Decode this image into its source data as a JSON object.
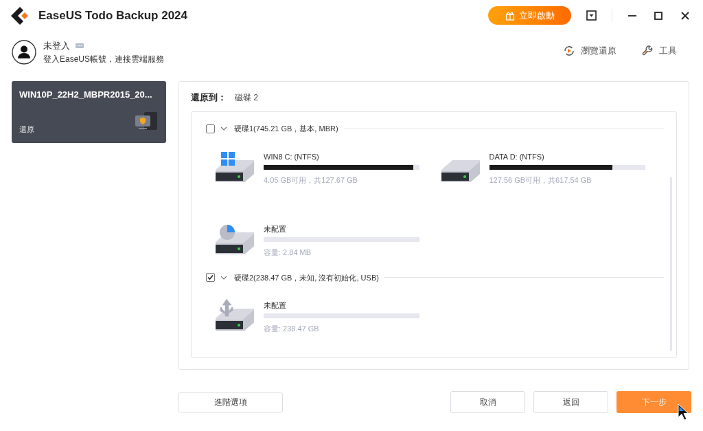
{
  "window": {
    "title": "EaseUS Todo Backup 2024"
  },
  "activate_button": {
    "label": "立即啟動"
  },
  "account": {
    "name": "未登入",
    "subtitle": "登入EaseUS帳號，連接雲端服務"
  },
  "toolbar": [
    {
      "kind": "browse",
      "label": "瀏覽還原"
    },
    {
      "kind": "tools",
      "label": "工具"
    }
  ],
  "backup_card": {
    "title": "WIN10P_22H2_MBPR2015_20...",
    "subtitle": "還原",
    "selected": true
  },
  "restore_to": {
    "label": "還原到：",
    "value": "磁碟 2"
  },
  "disks": [
    {
      "label": "硬碟1(745.21 GB，基本, MBR)",
      "checked": false,
      "expanded": true,
      "partitions": [
        {
          "kind": "windows",
          "name": "WIN8 C: (NTFS)",
          "level": 0.96,
          "info": "4.05 GB可用，共127.67 GB"
        },
        {
          "kind": "data",
          "name": "DATA D: (NTFS)",
          "level": 0.79,
          "info": "127.56 GB可用，共617.54 GB"
        },
        {
          "kind": "unallocated",
          "name": "未配置",
          "info": "容量: 2.84 MB"
        }
      ]
    },
    {
      "label": "硬碟2(238.47 GB，未知, 沒有初始化, USB)",
      "checked": true,
      "expanded": true,
      "partitions": [
        {
          "kind": "usb",
          "name": "未配置",
          "info": "容量: 238.47 GB"
        }
      ]
    }
  ],
  "buttons": {
    "advanced": "進階選項",
    "cancel": "取消",
    "back": "返回",
    "next": "下一步"
  }
}
